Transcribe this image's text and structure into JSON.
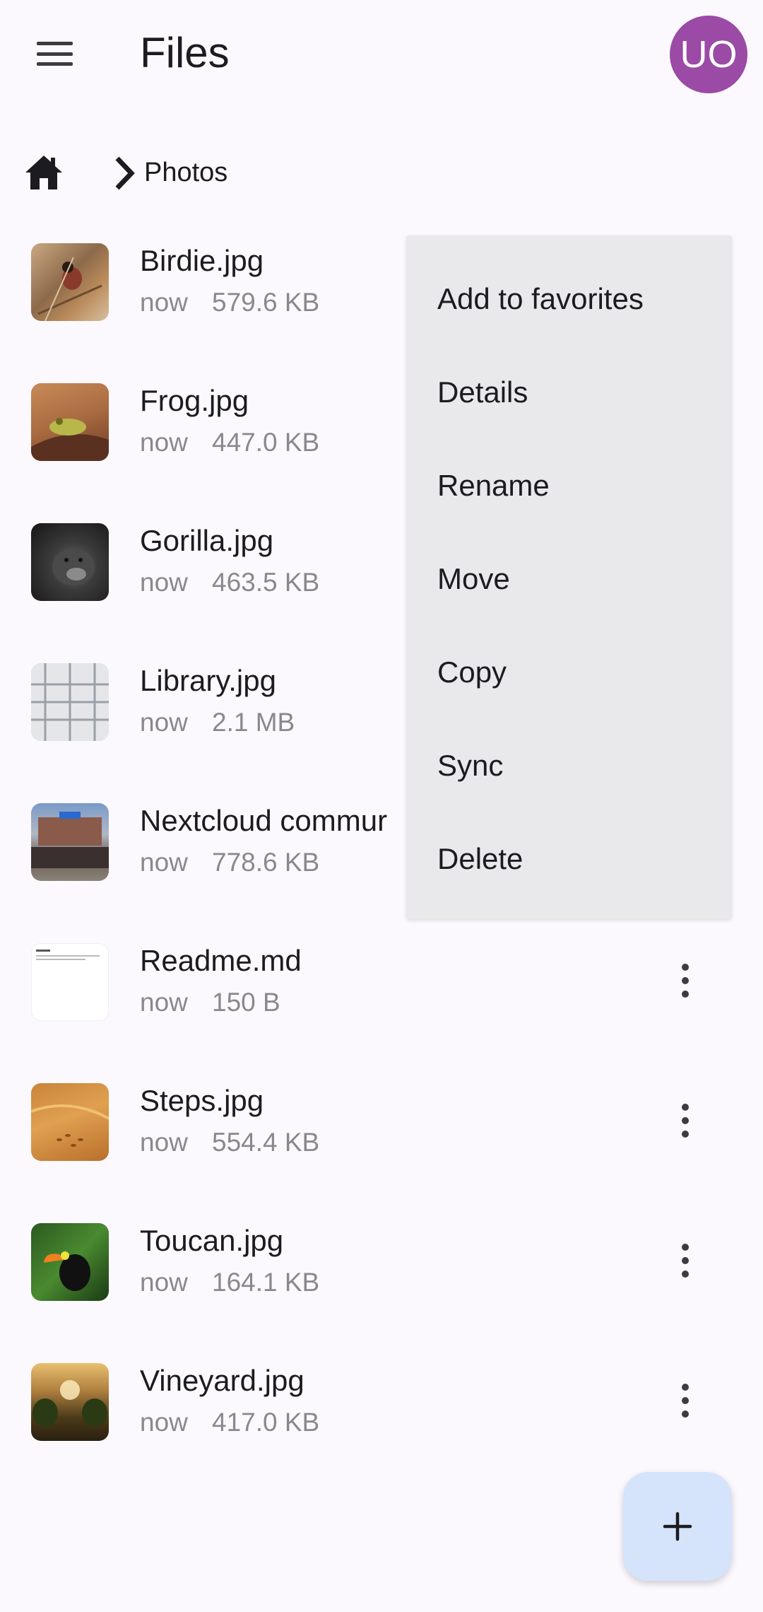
{
  "app_bar": {
    "title": "Files",
    "avatar_initials": "UO",
    "avatar_color": "#9b4aa6"
  },
  "breadcrumb": {
    "current": "Photos"
  },
  "files": [
    {
      "name": "Birdie.jpg",
      "time": "now",
      "size": "579.6 KB"
    },
    {
      "name": "Frog.jpg",
      "time": "now",
      "size": "447.0 KB"
    },
    {
      "name": "Gorilla.jpg",
      "time": "now",
      "size": "463.5 KB"
    },
    {
      "name": "Library.jpg",
      "time": "now",
      "size": "2.1 MB"
    },
    {
      "name": "Nextcloud commur",
      "time": "now",
      "size": "778.6 KB"
    },
    {
      "name": "Readme.md",
      "time": "now",
      "size": "150 B"
    },
    {
      "name": "Steps.jpg",
      "time": "now",
      "size": "554.4 KB"
    },
    {
      "name": "Toucan.jpg",
      "time": "now",
      "size": "164.1 KB"
    },
    {
      "name": "Vineyard.jpg",
      "time": "now",
      "size": "417.0 KB"
    }
  ],
  "context_menu": {
    "items": [
      "Add to favorites",
      "Details",
      "Rename",
      "Move",
      "Copy",
      "Sync",
      "Delete"
    ]
  },
  "icons": {
    "menu": "hamburger-menu-icon",
    "home": "home-icon",
    "separator": "chevron-right-icon",
    "more": "more-vert-icon",
    "fab": "plus-icon"
  },
  "colors": {
    "background": "#fbf9fd",
    "menu_surface": "#e9e8eb",
    "fab": "#d5e3fb",
    "secondary_text": "#8a888e"
  }
}
